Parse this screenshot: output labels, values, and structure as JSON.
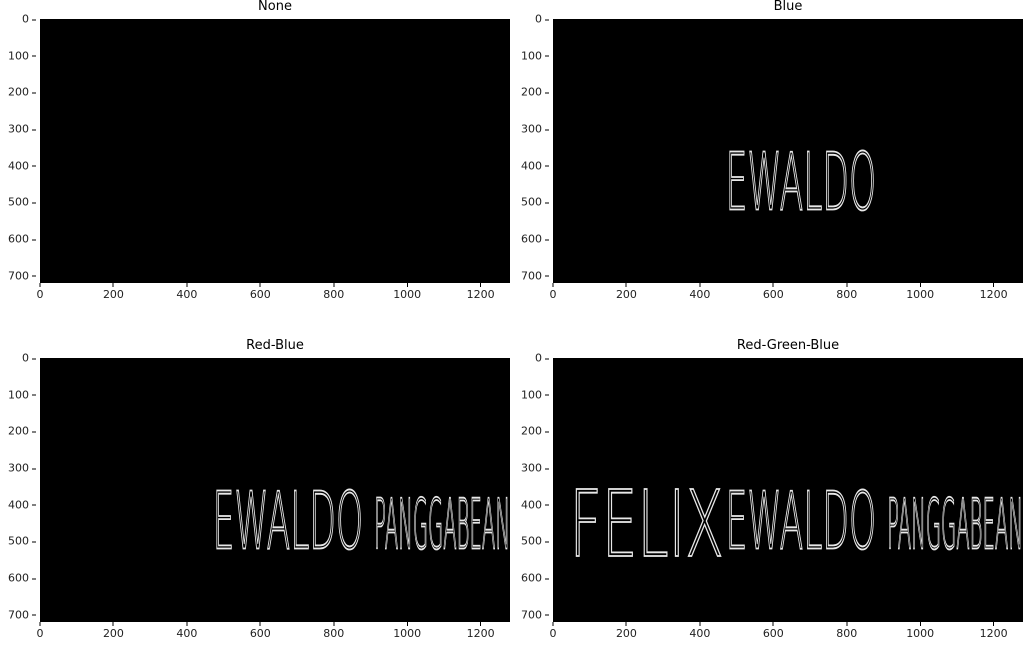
{
  "chart_data": [
    {
      "type": "image",
      "title": "None",
      "image_size": [
        1280,
        720
      ],
      "xticks": [
        0,
        200,
        400,
        600,
        800,
        1000,
        1200
      ],
      "yticks": [
        0,
        100,
        200,
        300,
        400,
        500,
        600,
        700
      ],
      "xlim": [
        0,
        1280
      ],
      "ylim": [
        720,
        0
      ],
      "handwriting": []
    },
    {
      "type": "image",
      "title": "Blue",
      "image_size": [
        1280,
        720
      ],
      "xticks": [
        0,
        200,
        400,
        600,
        800,
        1000,
        1200
      ],
      "yticks": [
        0,
        100,
        200,
        300,
        400,
        500,
        600,
        700
      ],
      "xlim": [
        0,
        1280
      ],
      "ylim": [
        720,
        0
      ],
      "handwriting": [
        {
          "text": "EWALDO",
          "x0": 470,
          "x1": 880,
          "y0": 360,
          "y1": 520
        }
      ]
    },
    {
      "type": "image",
      "title": "Red-Blue",
      "image_size": [
        1280,
        720
      ],
      "xticks": [
        0,
        200,
        400,
        600,
        800,
        1000,
        1200
      ],
      "yticks": [
        0,
        100,
        200,
        300,
        400,
        500,
        600,
        700
      ],
      "xlim": [
        0,
        1280
      ],
      "ylim": [
        720,
        0
      ],
      "handwriting": [
        {
          "text": "EWALDO",
          "x0": 470,
          "x1": 880,
          "y0": 360,
          "y1": 520
        },
        {
          "text": "PANGGABEAN",
          "x0": 910,
          "x1": 1280,
          "y0": 380,
          "y1": 520
        }
      ]
    },
    {
      "type": "image",
      "title": "Red-Green-Blue",
      "image_size": [
        1280,
        720
      ],
      "xticks": [
        0,
        200,
        400,
        600,
        800,
        1000,
        1200
      ],
      "yticks": [
        0,
        100,
        200,
        300,
        400,
        500,
        600,
        700
      ],
      "xlim": [
        0,
        1280
      ],
      "ylim": [
        720,
        0
      ],
      "handwriting": [
        {
          "text": "FELIX",
          "x0": 45,
          "x1": 465,
          "y0": 355,
          "y1": 540
        },
        {
          "text": "EWALDO",
          "x0": 470,
          "x1": 880,
          "y0": 360,
          "y1": 520
        },
        {
          "text": "PANGGABEAN",
          "x0": 910,
          "x1": 1280,
          "y0": 380,
          "y1": 520
        }
      ]
    }
  ]
}
